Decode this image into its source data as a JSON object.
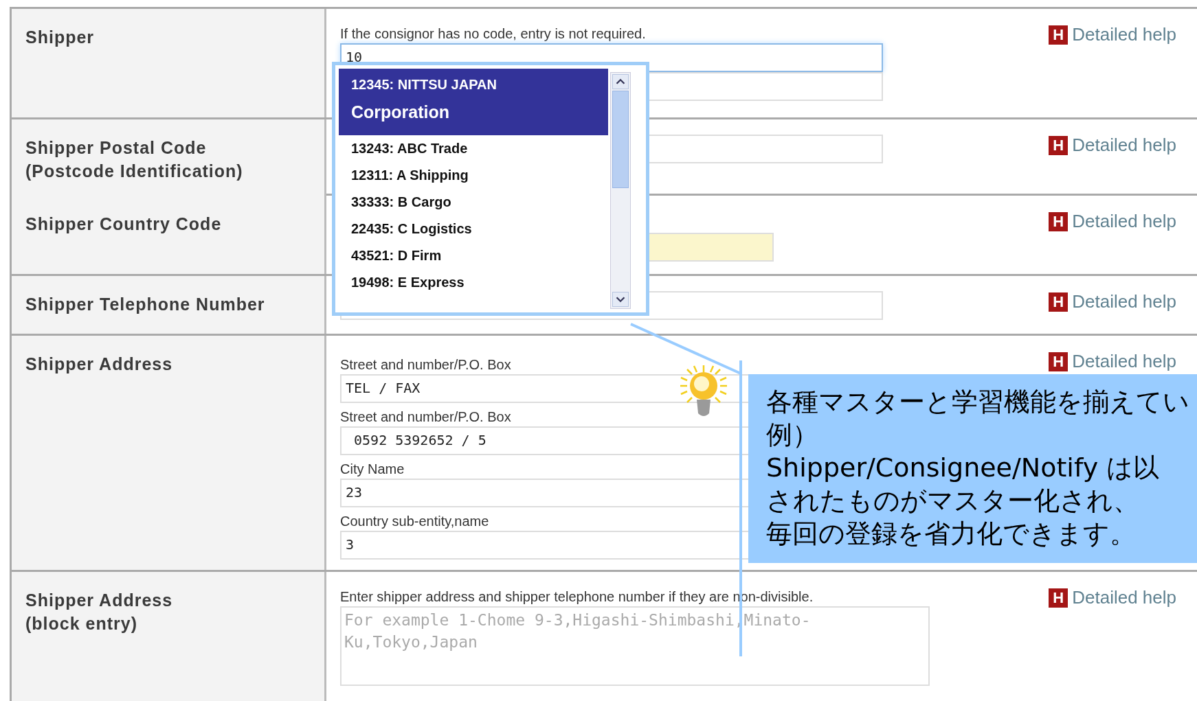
{
  "rows": [
    {
      "label": "Shipper",
      "hint": "If the consignor has no code, entry is not required.",
      "fields": [
        {
          "kind": "input",
          "value": "10",
          "focused": true,
          "required": false
        },
        {
          "kind": "input",
          "focused": false,
          "required": false
        }
      ],
      "help": {
        "icon": "H",
        "label": "Detailed help"
      }
    },
    {
      "label": "Shipper Postal Code\n(Postcode Identification)",
      "fields": [
        {
          "kind": "input",
          "focused": false,
          "required": false
        }
      ],
      "help": {
        "icon": "H",
        "label": "Detailed help"
      }
    },
    {
      "label": "Shipper Country Code",
      "fields": [
        {
          "kind": "short-input",
          "focused": false,
          "required": true
        }
      ],
      "help": {
        "icon": "H",
        "label": "Detailed help"
      }
    },
    {
      "label": "Shipper Telephone Number",
      "fields": [
        {
          "kind": "input",
          "focused": false,
          "required": false
        }
      ],
      "help": {
        "icon": "H",
        "label": "Detailed help"
      }
    },
    {
      "label": "Shipper Address",
      "fields": [
        {
          "kind": "input",
          "sublabel": "Street and number/P.O. Box",
          "value": "TEL / FAX",
          "focused": false,
          "required": false
        },
        {
          "kind": "input",
          "sublabel": "Street and number/P.O. Box",
          "value": " 0592 5392652 / 5",
          "focused": false,
          "required": false
        },
        {
          "kind": "input",
          "sublabel": "City Name",
          "value": "23",
          "focused": false,
          "required": false
        },
        {
          "kind": "input",
          "sublabel": "Country sub-entity,name",
          "value": "3",
          "focused": false,
          "required": false
        }
      ],
      "help": {
        "icon": "H",
        "label": "Detailed help"
      }
    },
    {
      "label": "Shipper Address\n(block entry)",
      "hint": "Enter shipper address and shipper telephone number if they are non-divisible.",
      "fields": [
        {
          "kind": "textarea",
          "placeholder": "For example 1-Chome 9-3,Higashi-Shimbashi,Minato-Ku,Tokyo,Japan",
          "focused": false,
          "required": false
        }
      ],
      "help": {
        "icon": "H",
        "label": "Detailed help"
      }
    }
  ],
  "autocomplete": {
    "items": [
      {
        "lines": [
          "12345: NITTSU JAPAN",
          "Corporation"
        ],
        "selected": true
      },
      {
        "lines": [
          "13243: ABC Trade"
        ],
        "selected": false
      },
      {
        "lines": [
          "12311: A Shipping"
        ],
        "selected": false
      },
      {
        "lines": [
          "33333: B Cargo"
        ],
        "selected": false
      },
      {
        "lines": [
          "22435: C Logistics"
        ],
        "selected": false
      },
      {
        "lines": [
          "43521: D Firm"
        ],
        "selected": false
      },
      {
        "lines": [
          "19498: E Express"
        ],
        "selected": false
      }
    ]
  },
  "callout": {
    "lines": [
      "各種マスターと学習機能を揃えてい",
      "例）",
      "Shipper/Consignee/Notify は以",
      "されたものがマスター化され、",
      "毎回の登録を省力化できます。"
    ]
  }
}
